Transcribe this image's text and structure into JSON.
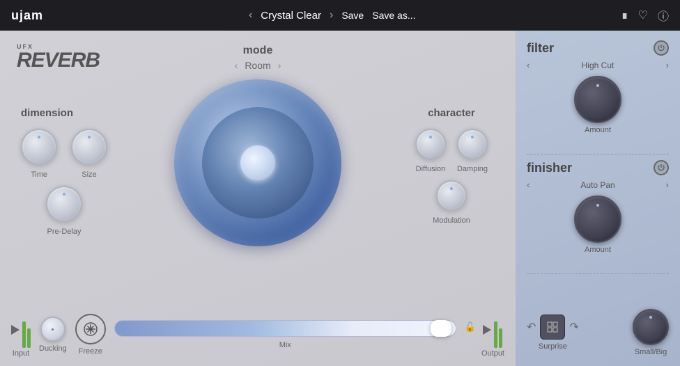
{
  "topbar": {
    "brand": "ujam",
    "preset": "Crystal Clear",
    "save_label": "Save",
    "save_as_label": "Save as..."
  },
  "mode": {
    "label": "mode",
    "value": "Room"
  },
  "dimension": {
    "title": "dimension",
    "knobs": [
      {
        "label": "Time"
      },
      {
        "label": "Size"
      },
      {
        "label": "Pre-Delay"
      }
    ]
  },
  "character": {
    "title": "character",
    "knobs": [
      {
        "label": "Diffusion"
      },
      {
        "label": "Damping"
      },
      {
        "label": "Modulation"
      }
    ]
  },
  "bottom": {
    "input_label": "Input",
    "ducking_label": "Ducking",
    "freeze_label": "Freeze",
    "mix_label": "Mix",
    "output_label": "Output"
  },
  "filter": {
    "title": "filter",
    "value": "High Cut",
    "amount_label": "Amount"
  },
  "finisher": {
    "title": "finisher",
    "value": "Auto Pan",
    "amount_label": "Amount"
  },
  "right_bottom": {
    "surprise_label": "Surprise",
    "small_big_label": "Small/Big"
  }
}
